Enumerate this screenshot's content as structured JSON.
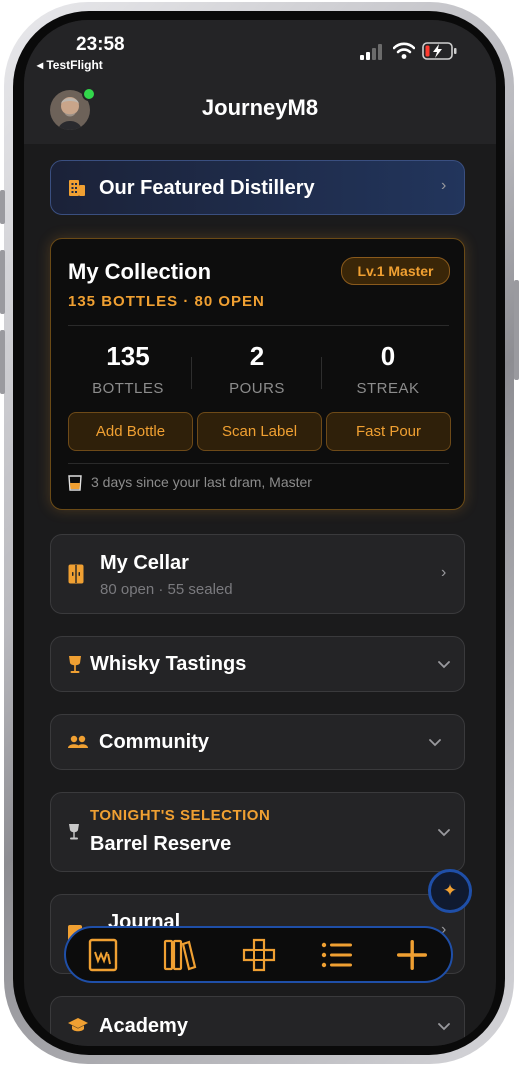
{
  "status_bar": {
    "time": "23:58",
    "back_label": "◂ TestFlight",
    "battery_color": "#ff3b30"
  },
  "header": {
    "app_name": "JourneyM8",
    "online_status_color": "#32d74b"
  },
  "featured": {
    "label": "Our Featured Distillery",
    "icon": "building-icon"
  },
  "collection": {
    "title": "My Collection",
    "summary": "135 BOTTLES · 80 OPEN",
    "level_badge": "Lv.1 Master",
    "stats": [
      {
        "value": "135",
        "label": "BOTTLES"
      },
      {
        "value": "2",
        "label": "POURS"
      },
      {
        "value": "0",
        "label": "STREAK"
      }
    ],
    "actions": [
      "Add Bottle",
      "Scan Label",
      "Fast Pour"
    ],
    "note": "3 days since your last dram, Master"
  },
  "sections": {
    "cellar": {
      "title": "My Cellar",
      "subtitle": "80 open · 55 sealed",
      "icon": "cabinet-icon"
    },
    "tastings": {
      "title": "Whisky Tastings",
      "icon": "wine-glass-icon"
    },
    "community": {
      "title": "Community",
      "icon": "people-icon"
    },
    "tonight": {
      "eyebrow": "TONIGHT'S SELECTION",
      "title": "Barrel Reserve",
      "icon": "wine-glass-icon"
    },
    "journal": {
      "title": "Journal",
      "icon": "book-icon"
    },
    "academy": {
      "title": "Academy",
      "icon": "graduation-cap-icon"
    }
  },
  "tab_bar": {
    "items": [
      "journal-tab-icon",
      "library-tab-icon",
      "explore-tab-icon",
      "list-tab-icon",
      "add-tab-icon"
    ]
  },
  "colors": {
    "accent": "#f0a032",
    "background": "#1b1b1c",
    "card": "#242426",
    "tabbar_border": "#1f4fa8"
  }
}
